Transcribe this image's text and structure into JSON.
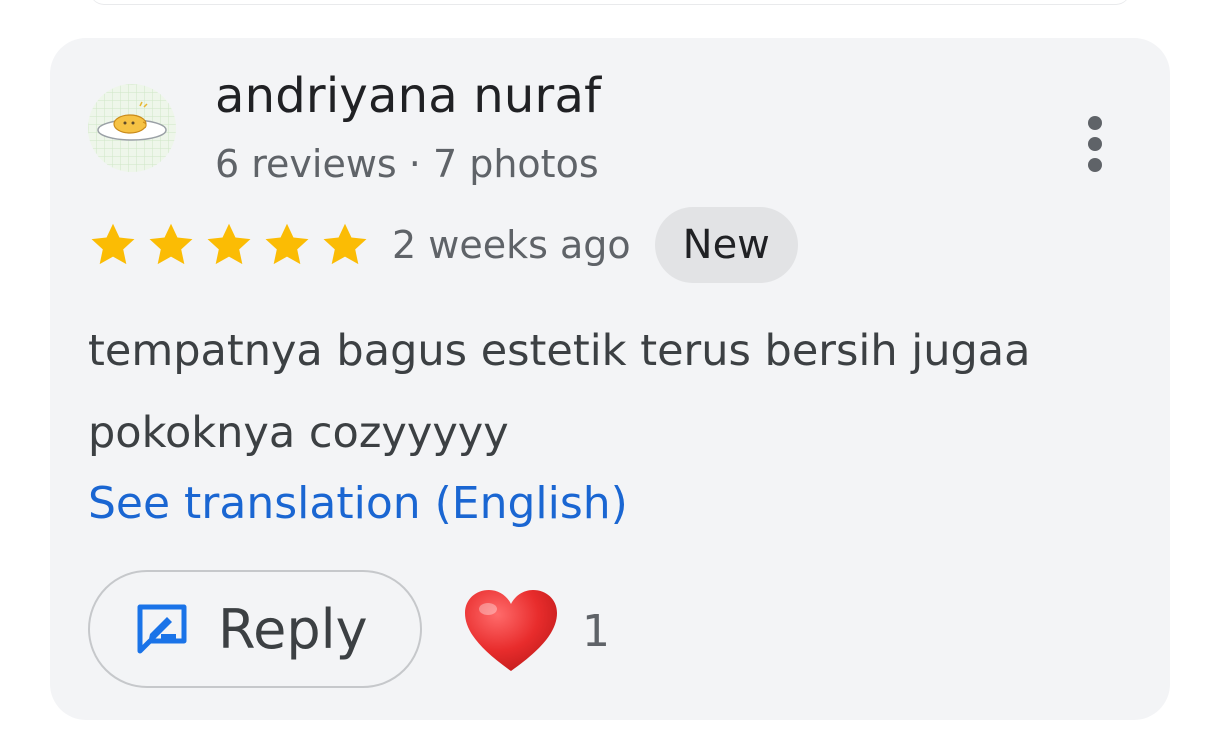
{
  "review": {
    "author": {
      "name": "andriyana nuraf",
      "meta": "6 reviews · 7 photos",
      "avatar_icon": "cartoon-egg-avatar-icon"
    },
    "rating": {
      "stars": 5,
      "max_stars": 5,
      "star_color": "#fbbc04"
    },
    "time": "2 weeks ago",
    "badge": "New",
    "text_lines": [
      "tempatnya bagus estetik terus bersih jugaa",
      "pokoknya cozyyyyy"
    ],
    "translate_link": "See translation (English)",
    "reply_label": "Reply",
    "reaction": {
      "icon": "red-heart-icon",
      "count": "1"
    },
    "colors": {
      "card_background": "#f3f4f6",
      "link": "#1a66d2",
      "reply_icon": "#1a73e8"
    }
  }
}
